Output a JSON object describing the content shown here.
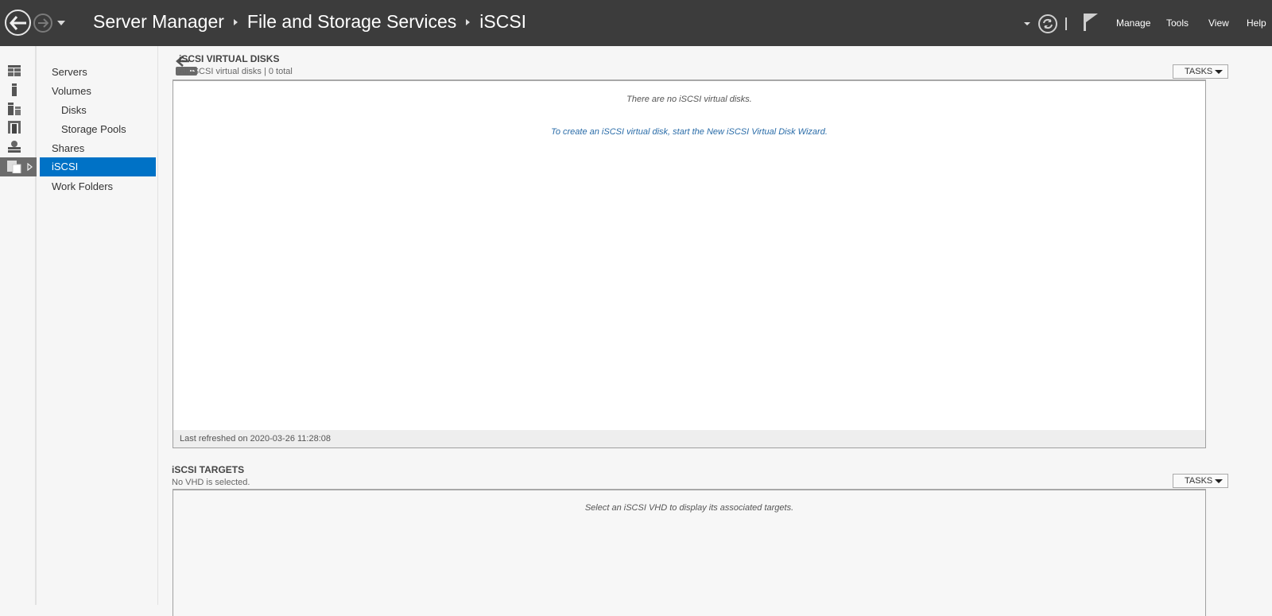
{
  "titlebar": {
    "breadcrumb": [
      "Server Manager",
      "File and Storage Services",
      "iSCSI"
    ],
    "menu": [
      "Manage",
      "Tools",
      "View",
      "Help"
    ],
    "icons": {
      "back": "back-arrow-icon",
      "forward": "forward-arrow-icon",
      "refresh": "refresh-icon",
      "notifications": "flag-icon"
    }
  },
  "leftbar": {
    "icons": [
      "dashboard-icon",
      "local-server-icon",
      "all-servers-icon",
      "server-group-icon",
      "iis-icon",
      "file-storage-icon"
    ]
  },
  "subnav": {
    "items": [
      {
        "label": "Servers"
      },
      {
        "label": "Volumes"
      },
      {
        "label": "Disks"
      },
      {
        "label": "Storage Pools"
      },
      {
        "label": "Shares"
      },
      {
        "label": "iSCSI"
      },
      {
        "label": "Work Folders"
      }
    ],
    "selected": "iSCSI"
  },
  "virtual_disks": {
    "title": "iSCSI VIRTUAL DISKS",
    "subtitle": "All iSCSI virtual disks | 0 total",
    "tasks_label": "TASKS",
    "empty_message": "There are no iSCSI virtual disks.",
    "wizard_link": "To create an iSCSI virtual disk, start the New iSCSI Virtual Disk Wizard.",
    "last_refreshed": "Last refreshed on 2020-03-26 11:28:08"
  },
  "targets": {
    "title": "iSCSI TARGETS",
    "subtitle": "No VHD is selected.",
    "tasks_label": "TASKS",
    "empty_message": "Select an iSCSI VHD to display its associated targets."
  },
  "colors": {
    "titlebar_bg": "#3c3c3c",
    "selection": "#0072c6",
    "link": "#2a6ca8"
  }
}
